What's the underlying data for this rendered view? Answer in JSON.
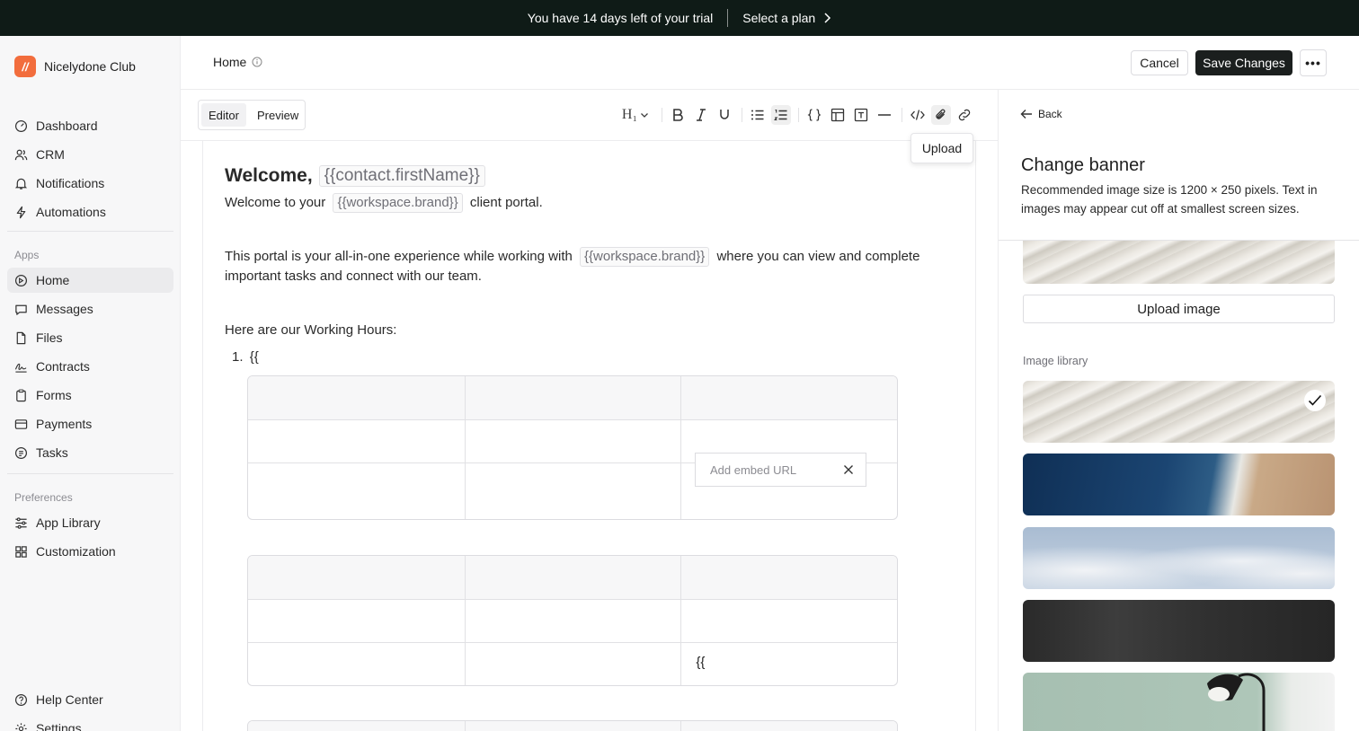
{
  "trial_banner": {
    "message": "You have 14 days left of your trial",
    "cta": "Select a plan"
  },
  "sidebar": {
    "workspace_name": "Nicelydone Club",
    "logo_letter": "//",
    "main_items": [
      {
        "label": "Dashboard",
        "icon": "dashboard-icon"
      },
      {
        "label": "CRM",
        "icon": "users-icon"
      },
      {
        "label": "Notifications",
        "icon": "bell-icon"
      },
      {
        "label": "Automations",
        "icon": "lightning-icon"
      }
    ],
    "apps_label": "Apps",
    "apps_items": [
      {
        "label": "Home",
        "icon": "compass-icon",
        "active": true
      },
      {
        "label": "Messages",
        "icon": "message-icon"
      },
      {
        "label": "Files",
        "icon": "file-icon"
      },
      {
        "label": "Contracts",
        "icon": "signature-icon"
      },
      {
        "label": "Forms",
        "icon": "clipboard-icon"
      },
      {
        "label": "Payments",
        "icon": "card-icon"
      },
      {
        "label": "Tasks",
        "icon": "tasks-icon"
      }
    ],
    "preferences_label": "Preferences",
    "pref_items": [
      {
        "label": "App Library",
        "icon": "sliders-icon"
      },
      {
        "label": "Customization",
        "icon": "grid-icon"
      }
    ],
    "footer_items": [
      {
        "label": "Help Center",
        "icon": "help-icon"
      },
      {
        "label": "Settings",
        "icon": "gear-icon"
      }
    ]
  },
  "header": {
    "title": "Home",
    "cancel_label": "Cancel",
    "save_label": "Save Changes",
    "more_label": "•••"
  },
  "editor": {
    "tabs": [
      "Editor",
      "Preview"
    ],
    "active_tab": "Editor",
    "heading_selector": "H₁",
    "tooltip": "Upload",
    "content": {
      "welcome": "Welcome,",
      "welcome_var": "{{contact.firstName}}",
      "line2_pre": "Welcome to your",
      "line2_var": "{{workspace.brand}}",
      "line2_post": "client portal.",
      "para_pre": "This portal is your all-in-one experience while working with",
      "para_var": "{{workspace.brand}}",
      "para_post": "where you can view and complete",
      "para_line2": "important tasks and connect with our team.",
      "hours": "Here are our Working Hours:",
      "list_num": "1.",
      "list_text": "{{",
      "table2_cell": "{{"
    },
    "embed_placeholder": "Add embed URL"
  },
  "panel": {
    "back_label": "Back",
    "title": "Change banner",
    "description": "Recommended image size is 1200 × 250 pixels. Text in images may appear cut off at smallest screen sizes.",
    "upload_label": "Upload image",
    "library_label": "Image library",
    "library": [
      {
        "name": "sand-dunes",
        "selected": true
      },
      {
        "name": "ocean-shore",
        "selected": false
      },
      {
        "name": "clouds",
        "selected": false
      },
      {
        "name": "dark-chalkboard",
        "selected": false
      },
      {
        "name": "lamp-green-wall",
        "selected": false
      }
    ]
  },
  "colors": {
    "banner_bg": "#0f1b17",
    "primary_button": "#1b1f1e",
    "brand_orange": "#f26d3d"
  }
}
